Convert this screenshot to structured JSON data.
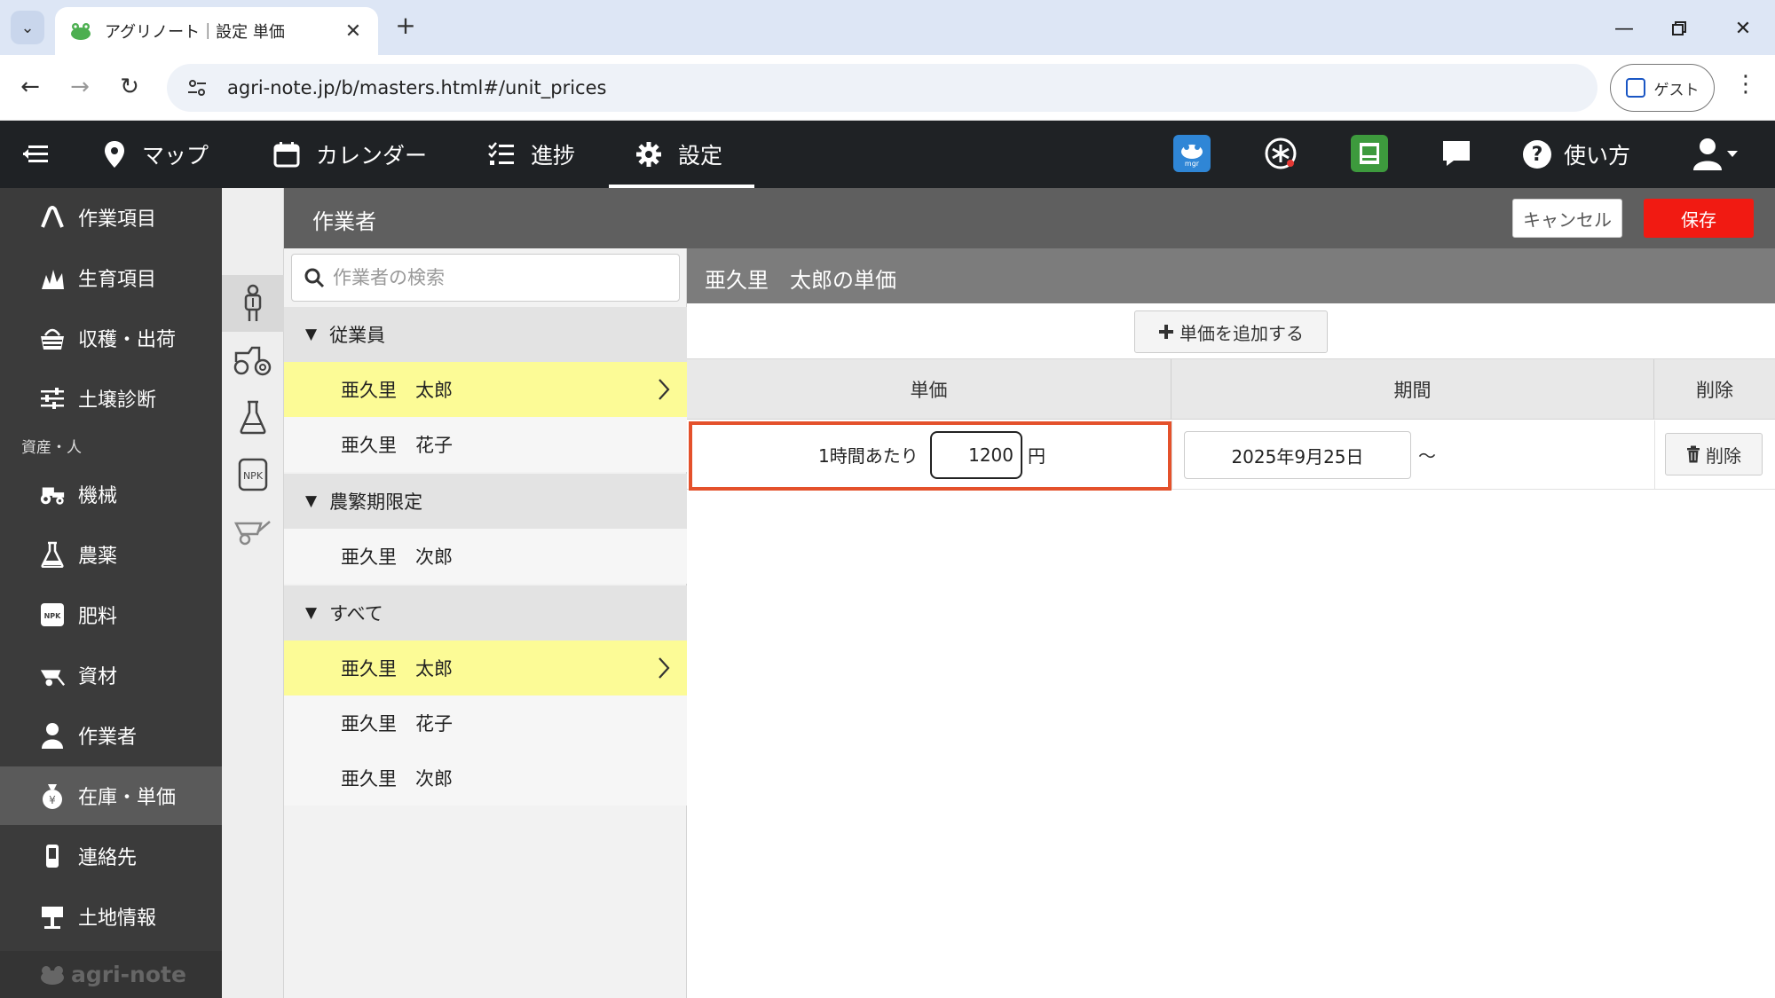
{
  "browser": {
    "tab_title": "アグリノート｜設定 単価",
    "url": "agri-note.jp/b/masters.html#/unit_prices",
    "profile_label": "ゲスト"
  },
  "header": {
    "nav": {
      "map": "マップ",
      "calendar": "カレンダー",
      "progress": "進捗",
      "settings": "設定"
    },
    "help_label": "使い方",
    "icons": [
      "mgr-icon",
      "service-icon",
      "farm-record-icon",
      "chat-icon"
    ]
  },
  "sidebar": {
    "items": [
      {
        "label": "作業項目",
        "icon": "work-item-icon"
      },
      {
        "label": "生育項目",
        "icon": "growth-icon"
      },
      {
        "label": "収穫・出荷",
        "icon": "harvest-basket-icon"
      },
      {
        "label": "土壌診断",
        "icon": "soil-sliders-icon"
      }
    ],
    "section_label": "資産・人",
    "asset_items": [
      {
        "label": "機械",
        "icon": "tractor-icon"
      },
      {
        "label": "農薬",
        "icon": "flask-icon"
      },
      {
        "label": "肥料",
        "icon": "npk-icon"
      },
      {
        "label": "資材",
        "icon": "wheelbarrow-icon"
      },
      {
        "label": "作業者",
        "icon": "person-icon"
      },
      {
        "label": "在庫・単価",
        "icon": "money-bag-icon"
      },
      {
        "label": "連絡先",
        "icon": "phone-icon"
      },
      {
        "label": "土地情報",
        "icon": "signpost-icon"
      }
    ],
    "active": "在庫・単価",
    "logo_text": "agri-note"
  },
  "page": {
    "title": "作業者",
    "cancel_label": "キャンセル",
    "save_label": "保存"
  },
  "colors": {
    "save_button": "#f11a12",
    "selected_row": "#fcfb96",
    "highlight_border": "#e4512b",
    "header_bg": "#1f2225",
    "sidebar_bg": "#3b3b3b"
  },
  "worker_list": {
    "search_placeholder": "作業者の検索",
    "groups": [
      {
        "name": "従業員",
        "workers": [
          "亜久里　太郎",
          "亜久里　花子"
        ]
      },
      {
        "name": "農繁期限定",
        "workers": [
          "亜久里　次郎"
        ]
      },
      {
        "name": "すべて",
        "workers": [
          "亜久里　太郎",
          "亜久里　花子",
          "亜久里　次郎"
        ]
      }
    ],
    "selected_worker": "亜久里　太郎"
  },
  "unit_price": {
    "title": "亜久里　太郎の単価",
    "add_label": "単価を追加する",
    "columns": [
      "単価",
      "期間",
      "削除"
    ],
    "rows": [
      {
        "per_label": "1時間あたり",
        "price": "1200",
        "currency": "円",
        "start_date": "2025年9月25日",
        "range_sep": "〜",
        "delete_label": "削除"
      }
    ]
  }
}
